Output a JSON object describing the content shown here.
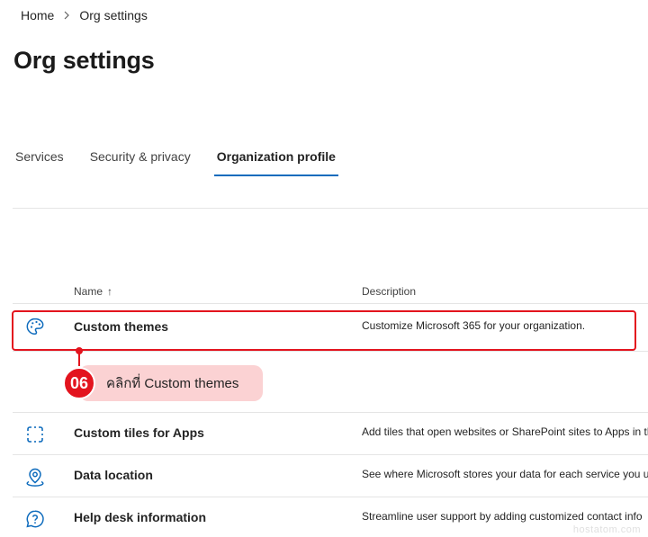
{
  "breadcrumb": {
    "home": "Home",
    "current": "Org settings"
  },
  "page": {
    "title": "Org settings"
  },
  "tabs": [
    {
      "label": "Services",
      "active": false
    },
    {
      "label": "Security & privacy",
      "active": false
    },
    {
      "label": "Organization profile",
      "active": true
    }
  ],
  "table": {
    "columns": {
      "name": "Name",
      "name_sort": "↑",
      "description": "Description"
    },
    "rows": [
      {
        "name": "Custom themes",
        "description": "Customize Microsoft 365 for your organization.",
        "icon": "palette-icon"
      },
      {
        "name": "Custom tiles for Apps",
        "description": "Add tiles that open websites or SharePoint sites to Apps in the app launcher",
        "icon": "dashed-square-icon"
      },
      {
        "name": "Data location",
        "description": "See where Microsoft stores your data for each service you use",
        "icon": "location-pin-icon"
      },
      {
        "name": "Help desk information",
        "description": "Streamline user support by adding customized contact info",
        "icon": "question-circle-icon"
      }
    ]
  },
  "callout": {
    "number": "06",
    "text": "คลิกที่ Custom themes"
  },
  "watermark": "hostatom.com",
  "colors": {
    "accent": "#0f6cbd",
    "highlight": "#e3141e",
    "callout_bg": "#fbd2d3",
    "icon": "#0f6cbd"
  }
}
